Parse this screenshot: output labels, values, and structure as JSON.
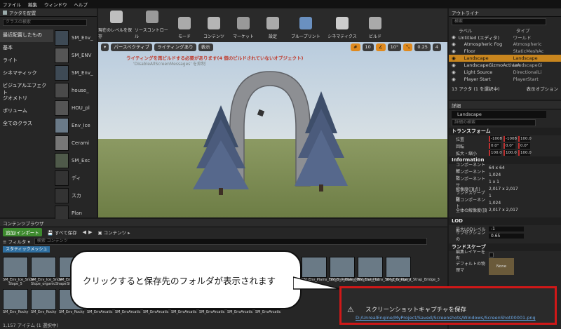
{
  "menu": [
    "ファイル",
    "編集",
    "ウィンドウ",
    "ヘルプ"
  ],
  "left_panel": {
    "tab": "アクタを配置",
    "search_placeholder": "クラスの検索",
    "categories": [
      "最近配置したもの",
      "基本",
      "ライト",
      "シネマティック",
      "ビジュアルエフェクト",
      "ジオメトリ",
      "ボリューム",
      "全てのクラス"
    ],
    "assets": [
      "SM_Env_",
      "SM_ENV",
      "SM_Env_",
      "house_",
      "HOU_pl",
      "Env_Ice",
      "Cerami",
      "SM_Exc",
      "ディ",
      "スカ",
      "Plan"
    ]
  },
  "toolbar": {
    "buttons": [
      "現在のレベルを保存",
      "ソースコントロール",
      "モード",
      "コンテンツ",
      "マーケット",
      "設定",
      "ブループリント",
      "シネマティクス",
      "ビルド"
    ]
  },
  "viewport": {
    "perspective_label": "パースペクティブ",
    "lighting_label": "ライティングあり",
    "show_label": "表示",
    "grid_value": "10",
    "angle_value": "10°",
    "scale_value": "0.25",
    "camera_value": "4",
    "warning": "ライティングを再ビルドする必要があります(4 個のビルドされていないオブジェクト)",
    "warning_sub": "'DisableAllScreenMessages' を抑制"
  },
  "outliner": {
    "tab": "アウトライナ",
    "search_placeholder": "検索",
    "col_label": "ラベル",
    "col_type": "タイプ",
    "rows": [
      {
        "label": "Untitled (エディタ)",
        "type": "ワールド"
      },
      {
        "label": "Atmospheric Fog",
        "type": "Atmospheric"
      },
      {
        "label": "Floor",
        "type": "StaticMeshAc"
      },
      {
        "label": "Landscape",
        "type": "Landscape"
      },
      {
        "label": "LandscapeGizmoActiveA",
        "type": "LandscapeGi"
      },
      {
        "label": "Light Source",
        "type": "DirectionalLi"
      },
      {
        "label": "Player Start",
        "type": "PlayerStart"
      }
    ],
    "count": "13 アクタ (1 を選択中)",
    "view_options": "表示オプション"
  },
  "details": {
    "tab": "詳細",
    "name": "Landscape",
    "search_placeholder": "詳細の検索",
    "transform_title": "トランスフォーム",
    "location_label": "位置",
    "location": [
      "-1008",
      "-1008",
      "100.0"
    ],
    "rotation_label": "回転",
    "rotation": [
      "0.0°",
      "0.0°",
      "0.0°"
    ],
    "scale_label": "拡大・縮小",
    "scale": [
      "100.0",
      "100.0",
      "100.0"
    ],
    "info_title": "Information",
    "info": [
      {
        "k": "コンポーネント解",
        "v": "64 x 64"
      },
      {
        "k": "コンポーネント数",
        "v": "1,024"
      },
      {
        "k": "コンポーネントサ",
        "v": "1 x 1"
      },
      {
        "k": "解像度(頂点)",
        "v": "2,017 x 2,017"
      },
      {
        "k": "ランドスケープ数",
        "v": "1"
      },
      {
        "k": "総コンポーネント",
        "v": "1,024"
      },
      {
        "k": "全体の解像度(頂",
        "v": "2,017 x 2,017"
      }
    ],
    "lod_title": "LOD",
    "lod": [
      {
        "k": "最大LODレベル",
        "v": "-1"
      },
      {
        "k": "サブセクションの",
        "v": "0.65"
      }
    ],
    "landscape_title": "ランドスケープ",
    "edit_layer": "編集レイヤーを有",
    "default_material": "デフォルトの物理マ",
    "none_label": "None"
  },
  "content_browser": {
    "tab": "コンテンツブラウザ",
    "add_import": "追加/インポート",
    "save_all": "すべて保存",
    "path": "コンテンツ",
    "filter": "フィルタ",
    "search_placeholder": "検索 コンテンツ",
    "chip": "スタティックメッシュ",
    "assets_row1": [
      "SM_Env_Ice_Snow Slope_5",
      "SM_Env_Ice_Snow Slope_organicShape",
      "SM_Env_Ice_Snow Slope",
      "SM_Env_Plains_Floors_Pebble_02",
      "SM_Env_Plains_Mountain_01",
      "SM_Env_Plains_Strap_Bridge_2",
      "SM_Env_Plains_Strap_Bridge_3"
    ],
    "assets_row2": [
      "SM_Env_Rocky",
      "SM_Env_Rocky",
      "SM_Env_Rocky",
      "SM_EnvArcatic",
      "SM_EnvArcatic",
      "SM_EnvArcatic",
      "SM_EnvArcatic",
      "SM_EnvArcatic",
      "SM_EnvArcatic",
      "SM_EnvArcatic"
    ],
    "count": "1,157 アイテム (1 選択中)"
  },
  "callout": "クリックすると保存先のフォルダが表示されます",
  "notification": {
    "title": "スクリーンショットキャプチャを保存",
    "path": "D:/UnrealEngine/MyProject/Saved/Screenshots/Windows/ScreenShot00001.png"
  }
}
